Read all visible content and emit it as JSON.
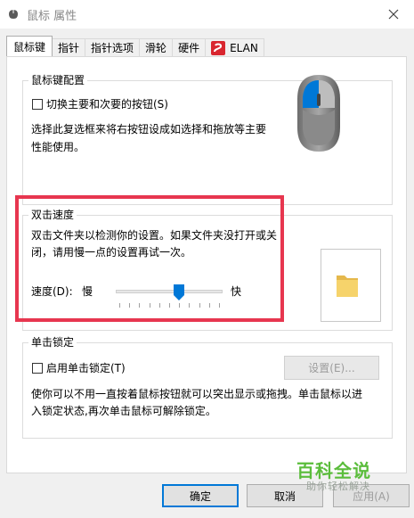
{
  "window": {
    "title": "鼠标 属性",
    "icon": "mouse-icon"
  },
  "tabs": [
    {
      "label": "鼠标键",
      "active": true
    },
    {
      "label": "指针",
      "active": false
    },
    {
      "label": "指针选项",
      "active": false
    },
    {
      "label": "滑轮",
      "active": false
    },
    {
      "label": "硬件",
      "active": false
    },
    {
      "label": "ELAN",
      "active": false,
      "icon": "elan-icon"
    }
  ],
  "button_config": {
    "legend": "鼠标键配置",
    "switch_label": "切换主要和次要的按钮(S)",
    "switch_checked": false,
    "description_line1": "选择此复选框来将右按钮设成如选择和拖放等主要",
    "description_line2": "性能使用。"
  },
  "double_click": {
    "legend": "双击速度",
    "description_line1": "双击文件夹以检测你的设置。如果文件夹没打开或关",
    "description_line2": "闭，请用慢一点的设置再试一次。",
    "speed_label": "速度(D):",
    "slow": "慢",
    "fast": "快",
    "speed_value": 0.6
  },
  "click_lock": {
    "legend": "单击锁定",
    "enable_label": "启用单击锁定(T)",
    "enable_checked": false,
    "settings_button": "设置(E)...",
    "description_line1": "使你可以不用一直按着鼠标按钮就可以突出显示或拖拽。单击鼠标以进",
    "description_line2": "入锁定状态,再次单击鼠标可解除锁定。"
  },
  "footer": {
    "ok": "确定",
    "cancel": "取消",
    "apply": "应用(A)"
  },
  "watermark": {
    "title": "百科全说",
    "subtitle": "助你轻松解决"
  },
  "colors": {
    "highlight": "#e7364f",
    "accent": "#0078d7",
    "watermark": "#5bbd3c"
  }
}
